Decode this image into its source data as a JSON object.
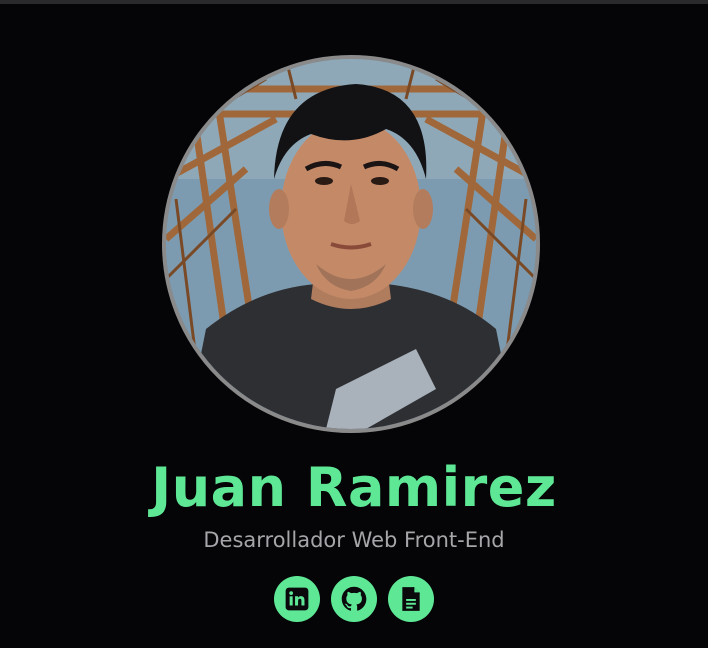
{
  "profile": {
    "name": "Juan Ramirez",
    "role": "Desarrollador Web Front-End",
    "photo_alt": "profile photo"
  },
  "socials": [
    {
      "icon": "linkedin-icon"
    },
    {
      "icon": "github-icon"
    },
    {
      "icon": "document-icon"
    }
  ],
  "colors": {
    "background": "#050507",
    "accent": "#5ee896",
    "subtitle": "#a6a6aa",
    "ring": "#8a8a8a"
  }
}
